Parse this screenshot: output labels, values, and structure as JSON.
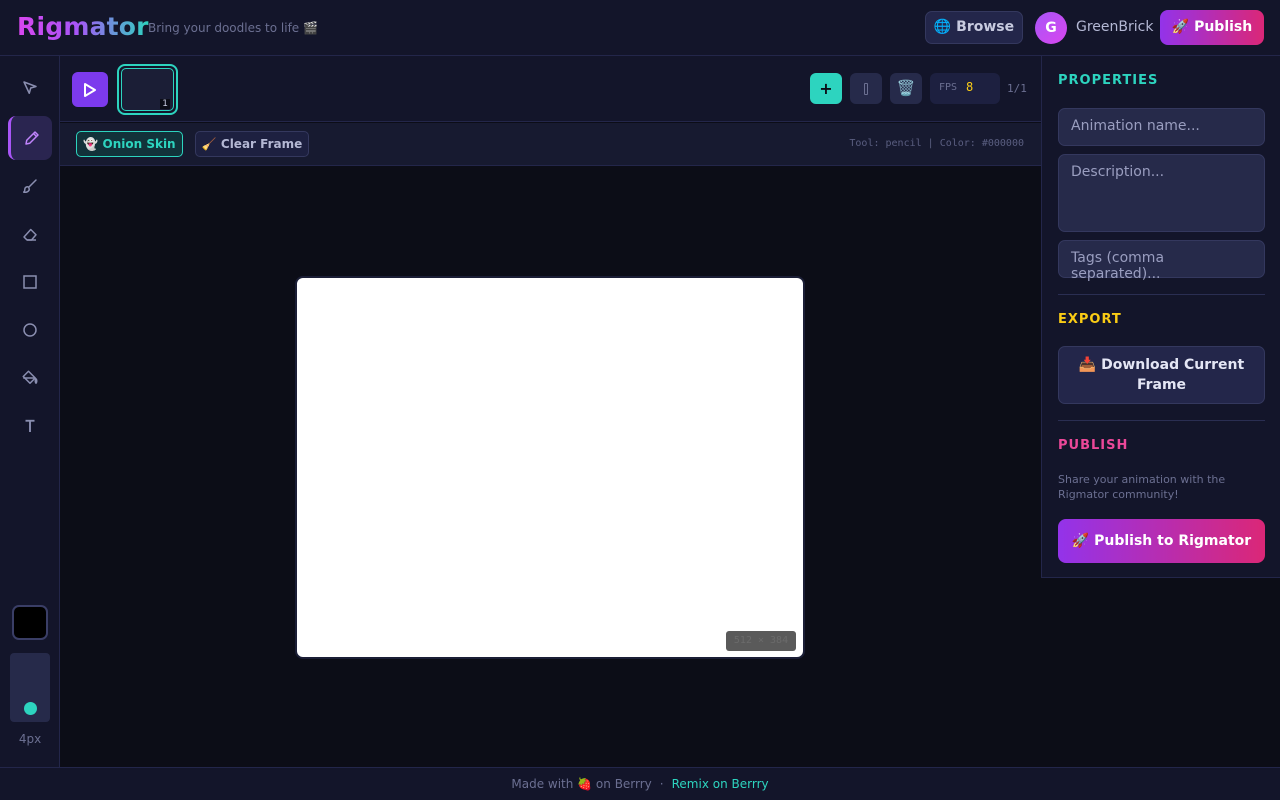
{
  "header": {
    "logo": "Rigmator",
    "tagline": "Bring your doodles to life 🎬",
    "browse_label": "🌐 Browse",
    "avatar_initial": "G",
    "username": "GreenBrick",
    "publish_label": "🚀 Publish"
  },
  "toolbar": {
    "tools": [
      {
        "name": "select",
        "icon": "cursor-icon"
      },
      {
        "name": "pencil",
        "icon": "pencil-icon",
        "active": true
      },
      {
        "name": "brush",
        "icon": "brush-icon"
      },
      {
        "name": "eraser",
        "icon": "eraser-icon"
      },
      {
        "name": "rectangle",
        "icon": "square-icon"
      },
      {
        "name": "circle",
        "icon": "circle-icon"
      },
      {
        "name": "fill",
        "icon": "paint-bucket-icon"
      },
      {
        "name": "text",
        "icon": "text-icon"
      }
    ],
    "current_color": "#000000",
    "brush_size_label": "4px"
  },
  "timeline": {
    "frames": [
      {
        "number": "1"
      }
    ],
    "add_label": "+",
    "delete_icon": "🗑️",
    "fps_label": "FPS",
    "fps_value": "8",
    "frame_count": "1/1"
  },
  "options": {
    "onion_skin_label": "👻 Onion Skin",
    "clear_frame_label": "🧹 Clear Frame",
    "status": "Tool: pencil | Color: #000000"
  },
  "canvas": {
    "size_label": "512 × 384"
  },
  "panel": {
    "properties_title": "PROPERTIES",
    "name_placeholder": "Animation name...",
    "description_placeholder": "Description...",
    "tags_placeholder": "Tags (comma separated)...",
    "export_title": "EXPORT",
    "download_label": "📥 Download Current Frame",
    "publish_title": "PUBLISH",
    "share_text": "Share your animation with the Rigmator community!",
    "publish_label": "🚀 Publish to Rigmator"
  },
  "footer": {
    "made_with": "Made with 🍓 on Berrry",
    "separator": "·",
    "remix_label": "Remix on Berrry"
  },
  "colors": {
    "accent_purple": "#a855f7",
    "accent_teal": "#2dd4bf",
    "accent_pink": "#ec4899",
    "accent_yellow": "#facc15"
  }
}
